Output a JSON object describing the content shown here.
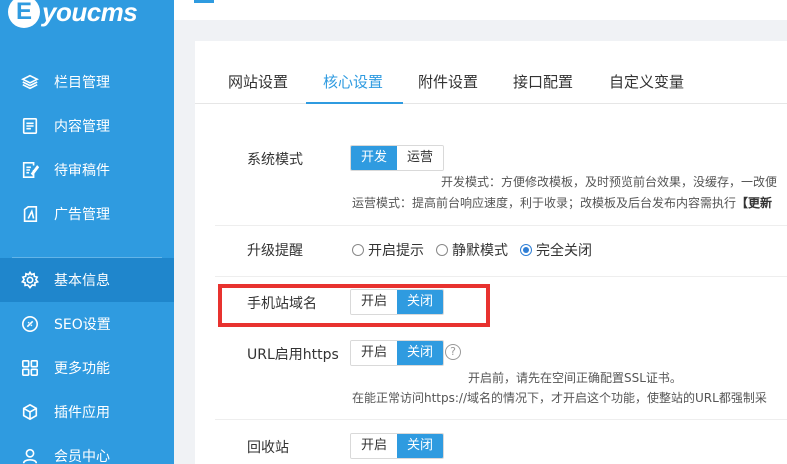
{
  "logo": {
    "letter": "E",
    "text": "youcms"
  },
  "sidebar": {
    "items": [
      {
        "label": "栏目管理",
        "icon": "layers-icon"
      },
      {
        "label": "内容管理",
        "icon": "document-icon"
      },
      {
        "label": "待审稿件",
        "icon": "edit-document-icon"
      },
      {
        "label": "广告管理",
        "icon": "ad-icon"
      },
      {
        "label": "基本信息",
        "icon": "gear-icon"
      },
      {
        "label": "SEO设置",
        "icon": "seo-icon"
      },
      {
        "label": "更多功能",
        "icon": "grid-icon"
      },
      {
        "label": "插件应用",
        "icon": "cube-icon"
      },
      {
        "label": "会员中心",
        "icon": "user-icon"
      }
    ]
  },
  "tabs": [
    {
      "label": "网站设置"
    },
    {
      "label": "核心设置"
    },
    {
      "label": "附件设置"
    },
    {
      "label": "接口配置"
    },
    {
      "label": "自定义变量"
    }
  ],
  "settings": {
    "system_mode": {
      "label": "系统模式",
      "options": [
        "开发",
        "运营"
      ],
      "note_dev": "开发模式：方便修改模板，及时预览前台效果，没缓存，一改便",
      "note_ops": "运营模式：提高前台响应速度，利于收录；改模板及后台发布内容需执行【更新",
      "note_ops_prefix": "运营模式：提高前台响应速度，利于收录；改模板及后台发布内容需执行",
      "note_ops_link": "【更新"
    },
    "upgrade_notice": {
      "label": "升级提醒",
      "options": [
        "开启提示",
        "静默模式",
        "完全关闭"
      ],
      "selected": "完全关闭"
    },
    "mobile_domain": {
      "label": "手机站域名",
      "options": [
        "开启",
        "关闭"
      ]
    },
    "url_https": {
      "label": "URL启用https",
      "options": [
        "开启",
        "关闭"
      ],
      "help": "?",
      "note1": "开启前，请先在空间正确配置SSL证书。",
      "note2": "在能正常访问https://域名的情况下，才开启这个功能，使整站的URL都强制采"
    },
    "recycle_bin": {
      "label": "回收站",
      "options": [
        "开启",
        "关闭"
      ]
    }
  },
  "colors": {
    "primary": "#2f9be0",
    "highlight": "#e8322f"
  }
}
